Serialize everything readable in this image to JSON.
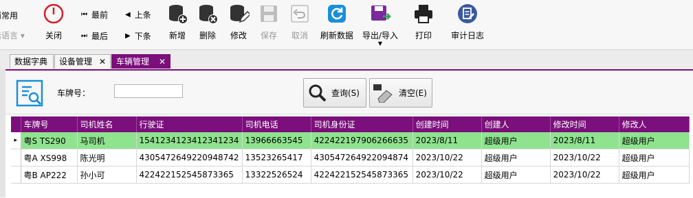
{
  "toolbar": {
    "left_top": "消常用",
    "left_bottom": "选语言",
    "close": "关闭",
    "first": "最前",
    "prev": "上条",
    "last": "最后",
    "next": "下条",
    "add": "新增",
    "delete": "删除",
    "edit": "修改",
    "save": "保存",
    "cancel": "取消",
    "refresh": "刷新数据",
    "export_import": "导出/导入",
    "print": "打印",
    "audit_log": "审计日志"
  },
  "tabs": [
    {
      "label": "数据字典",
      "active": false
    },
    {
      "label": "设备管理",
      "active": false,
      "close": "✕"
    },
    {
      "label": "车辆管理",
      "active": true,
      "close": "✕"
    }
  ],
  "search": {
    "plate_label": "车牌号：",
    "plate_value": "",
    "query_button": "查询(S)",
    "clear_button": "清空(E)"
  },
  "table": {
    "columns": [
      "车牌号",
      "司机姓名",
      "行驶证",
      "司机电话",
      "司机身份证",
      "创建时间",
      "创建人",
      "修改时间",
      "修改人"
    ],
    "rows": [
      [
        "粤S TS290",
        "马司机",
        "1541234123412341234",
        "13966663545",
        "422422197906266635",
        "2023/8/11",
        "超级用户",
        "2023/8/11",
        "超级用户"
      ],
      [
        "粤A XS998",
        "陈光明",
        "4305472649220948742",
        "13523265417",
        "430547264922094874",
        "2023/10/22",
        "超级用户",
        "2023/10/22",
        "超级用户"
      ],
      [
        "粤B AP222",
        "孙小可",
        "422422152545873365",
        "13322526524",
        "422422152545873365",
        "2023/10/22",
        "超级用户",
        "2023/10/22",
        "超级用户"
      ]
    ],
    "selected_row": 0,
    "row_indicator": "▸"
  },
  "colors": {
    "accent": "#7b0f7b",
    "selected_row": "#8fe38f"
  }
}
